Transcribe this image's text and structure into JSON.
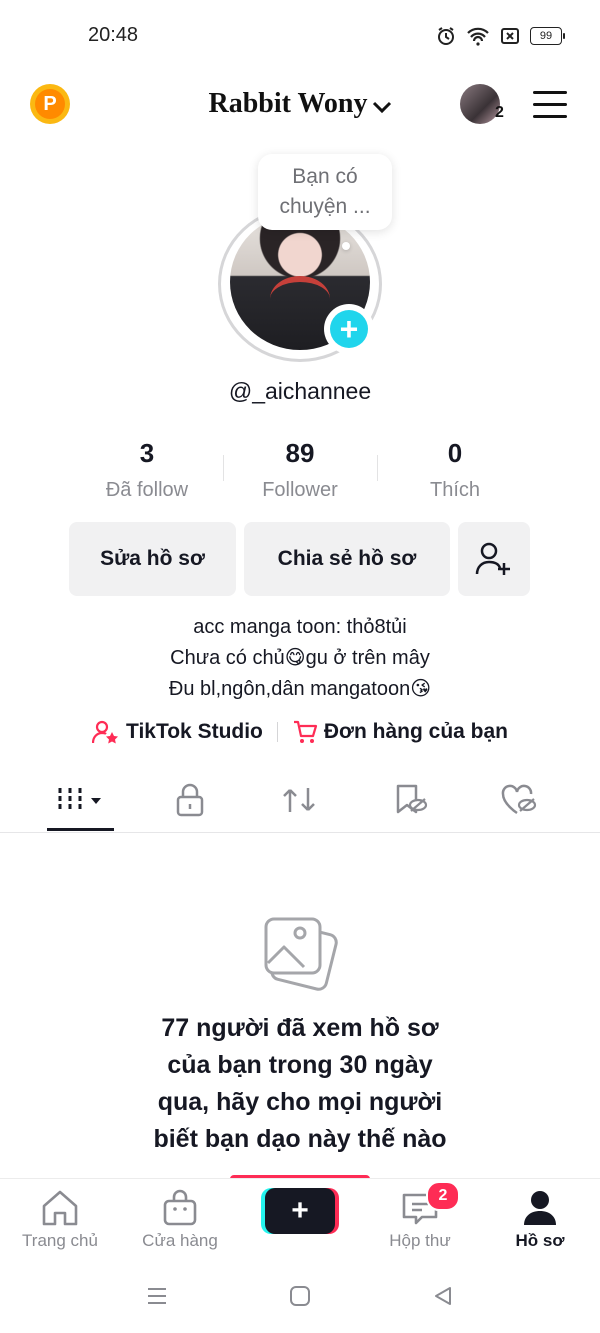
{
  "status_bar": {
    "time": "20:48",
    "battery": "99"
  },
  "header": {
    "coin_letter": "P",
    "title": "Rabbit Wony",
    "friend_count": "2"
  },
  "profile": {
    "bubble_text_line1": "Bạn có",
    "bubble_text_line2": "chuyện ...",
    "avatar_add": "+",
    "username": "@_aichannee"
  },
  "stats": [
    {
      "value": "3",
      "label": "Đã follow"
    },
    {
      "value": "89",
      "label": "Follower"
    },
    {
      "value": "0",
      "label": "Thích"
    }
  ],
  "actions": {
    "edit_profile": "Sửa hồ sơ",
    "share_profile": "Chia sẻ hồ sơ"
  },
  "bio": {
    "line1": "acc manga toon: thỏ8tủi",
    "line2": "Chưa có chủ😋gu ở trên mây",
    "line3": "Đu bl,ngôn,dân mangatoon😘"
  },
  "links": {
    "studio": "TikTok Studio",
    "orders": "Đơn hàng của bạn",
    "studio_color": "#fe2c55",
    "orders_color": "#fe2c55"
  },
  "tabs": [
    "videos-grid-icon",
    "lock-icon",
    "repost-icon",
    "favorites-hidden-icon",
    "liked-hidden-icon"
  ],
  "empty_state": {
    "line1": "77 người đã xem hồ sơ",
    "line2": "của bạn trong 30 ngày",
    "line3": "qua, hãy cho mọi người",
    "line4": "biết bạn dạo này thế nào"
  },
  "bottom_nav": {
    "home": "Trang chủ",
    "shop": "Cửa hàng",
    "create": "+",
    "inbox": "Hộp thư",
    "inbox_badge": "2",
    "profile": "Hồ sơ"
  },
  "colors": {
    "accent": "#fe2c55",
    "cyan": "#25f4ee",
    "avatar_add": "#20d5ec"
  }
}
